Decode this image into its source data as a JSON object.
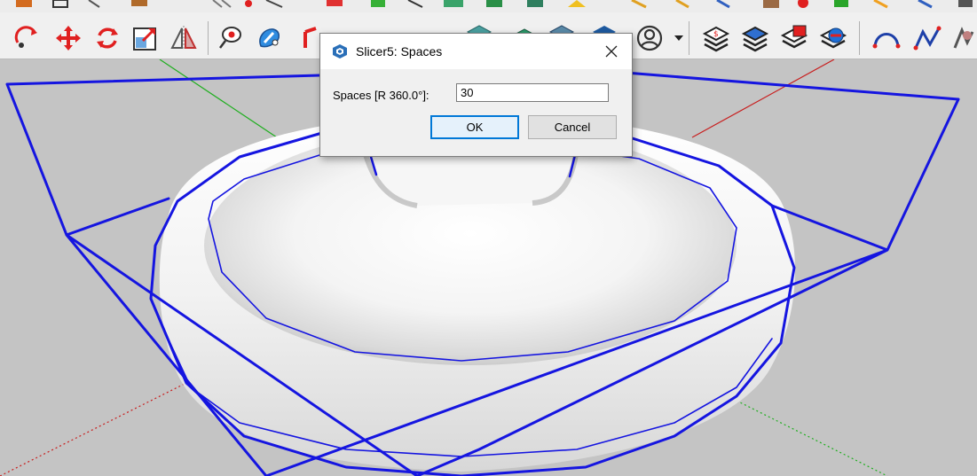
{
  "dialog": {
    "title": "Slicer5: Spaces",
    "field_label": "Spaces [R 360.0°]:",
    "field_value": "30",
    "ok_label": "OK",
    "cancel_label": "Cancel"
  },
  "toolbar": {
    "icons": [
      "orbit-arrow-icon",
      "move-icon",
      "rotate-icon",
      "scale-icon",
      "flip-icon",
      "lasso-icon",
      "paint-icon",
      "slice-icon",
      "layers-icon",
      "profile-icon",
      "chevron-down-icon",
      "stack-money-icon",
      "stack-blue-icon",
      "stack-red-icon",
      "stack-globe-icon",
      "arc-icon",
      "zigzag-icon",
      "tool-icon"
    ]
  },
  "colors": {
    "accent": "#0078d7",
    "wireframe": "#1515e0",
    "axis_red": "#c81e1e",
    "axis_green": "#1fae1f",
    "background": "#c4c4c4"
  }
}
